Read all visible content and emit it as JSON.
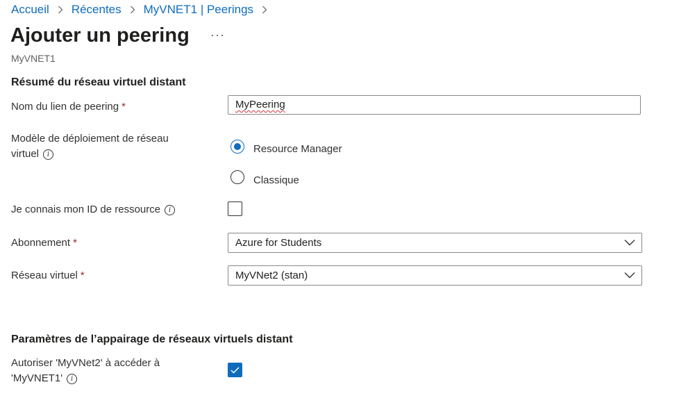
{
  "breadcrumb": {
    "items": [
      "Accueil",
      "Récentes",
      "MyVNET1 | Peerings"
    ]
  },
  "header": {
    "title": "Ajouter un peering",
    "more": "···",
    "subtitle": "MyVNET1"
  },
  "remote_section": {
    "heading": "Résumé du réseau virtuel distant",
    "peering_name": {
      "label": "Nom du lien de peering",
      "required": "*",
      "value": "MyPeering"
    },
    "deployment_model": {
      "label": "Modèle de déploiement de réseau virtuel",
      "options": [
        "Resource Manager",
        "Classique"
      ],
      "selected": "Resource Manager"
    },
    "know_resource_id": {
      "label": "Je connais mon ID de ressource",
      "checked": false
    },
    "subscription": {
      "label": "Abonnement",
      "required": "*",
      "value": "Azure for Students"
    },
    "virtual_network": {
      "label": "Réseau virtuel",
      "required": "*",
      "value": "MyVNet2 (stan)"
    }
  },
  "remote_settings": {
    "heading": "Paramètres de l’appairage de réseaux virtuels distant",
    "allow_access": {
      "label": "Autoriser 'MyVNet2' à accéder à 'MyVNET1'",
      "checked": true
    }
  },
  "colors": {
    "accent": "#0f6cbd",
    "required": "#a4262c",
    "text": "#323130"
  }
}
